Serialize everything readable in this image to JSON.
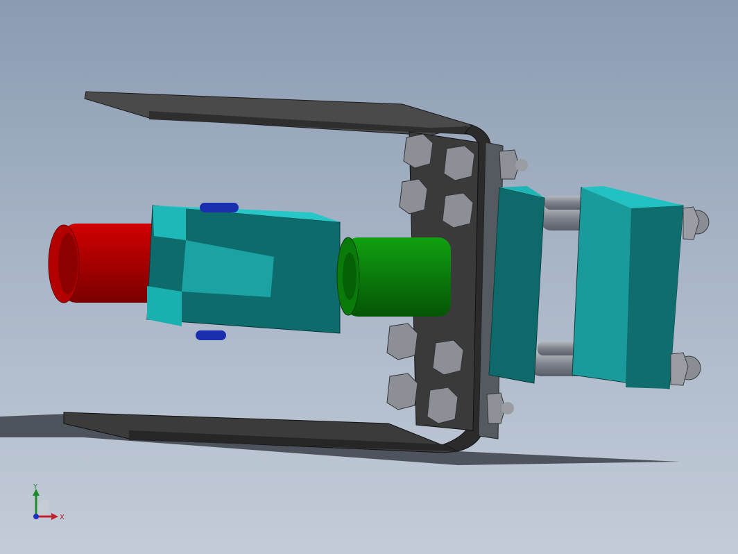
{
  "viewport": {
    "background_top": "#8b9bb2",
    "background_bottom": "#c3ccd8"
  },
  "model": {
    "parts": [
      {
        "name": "channel-bracket",
        "color": "#3a3a3a"
      },
      {
        "name": "red-cylinder-rod",
        "color": "#b00000"
      },
      {
        "name": "clevis-block",
        "color": "#1fb5b5"
      },
      {
        "name": "green-coupling",
        "color": "#0a8a0a"
      },
      {
        "name": "mounting-plate",
        "color": "#1fa5a5"
      },
      {
        "name": "hex-bolts",
        "color": "#8a8d93"
      },
      {
        "name": "blue-pin",
        "color": "#1a2fb0"
      }
    ]
  },
  "triad": {
    "x_label": "X",
    "y_label": "Y",
    "x_color": "#c0202a",
    "y_color": "#1d8a2a",
    "z_color": "#2030c0"
  }
}
